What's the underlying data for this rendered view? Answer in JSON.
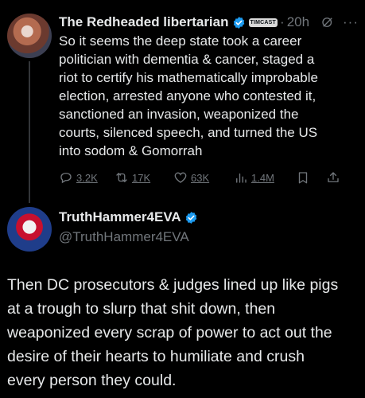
{
  "tweet1": {
    "author_name": "The Redheaded libertarian",
    "affiliate_badge": "TIMCAST",
    "separator": "·",
    "time": "20h",
    "more_label": "···",
    "text": "So it seems the deep state took a career\npolitician with dementia & cancer, staged a\nriot to certify his mathematically improbable\nelection, arrested anyone who contested it,\nsanctioned an invasion, weaponized the\ncourts, silenced speech, and turned the US\ninto sodom & Gomorrah",
    "replies": "3.2K",
    "reposts": "17K",
    "likes": "63K",
    "views": "1.4M"
  },
  "tweet2": {
    "author_name": "TruthHammer4EVA",
    "handle": "@TruthHammer4EVA",
    "text": "Then DC prosecutors & judges lined up like pigs\nat a trough to slurp that shit down, then\nweaponized every scrap of power to act out the\ndesire of their hearts to humiliate and crush\nevery person they could."
  },
  "colors": {
    "background": "#000000",
    "text": "#e7e9ea",
    "secondary": "#71767b",
    "verified": "#1d9bf0"
  },
  "icons": [
    "verified-icon",
    "grok-icon",
    "reply-icon",
    "repost-icon",
    "like-icon",
    "views-icon",
    "bookmark-icon",
    "share-icon"
  ]
}
